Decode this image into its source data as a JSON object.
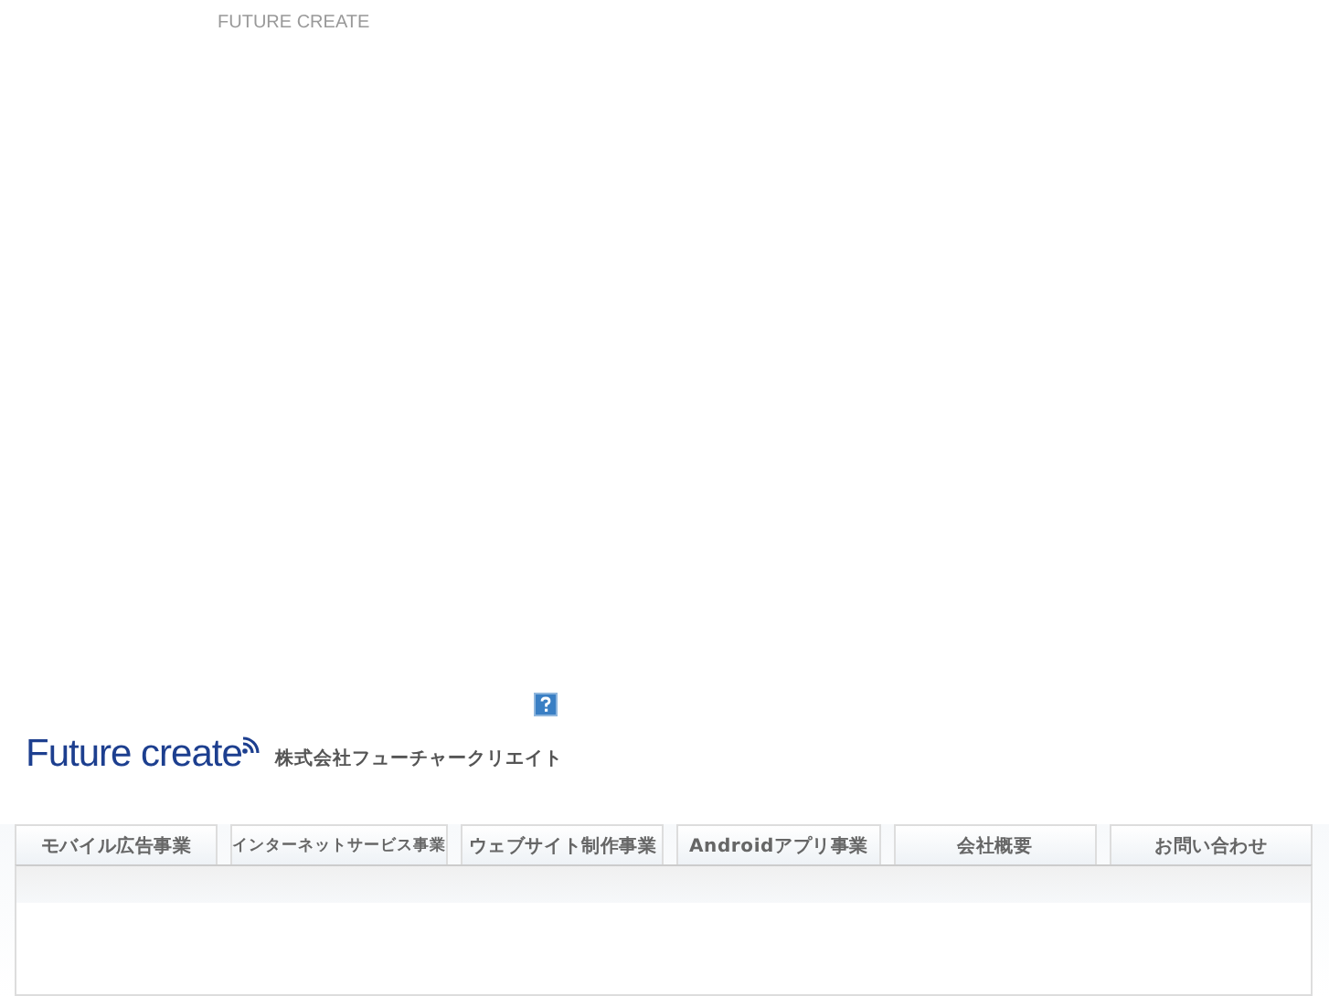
{
  "header": {
    "tagline": "FUTURE CREATE"
  },
  "logo": {
    "text": "Future create",
    "company": "株式会社フューチャークリエイト"
  },
  "nav": [
    {
      "label": "モバイル広告事業"
    },
    {
      "label": "インターネットサービス事業"
    },
    {
      "label": "ウェブサイト制作事業"
    },
    {
      "label": "Androidアプリ事業"
    },
    {
      "label": "会社概要"
    },
    {
      "label": "お問い合わせ"
    }
  ]
}
